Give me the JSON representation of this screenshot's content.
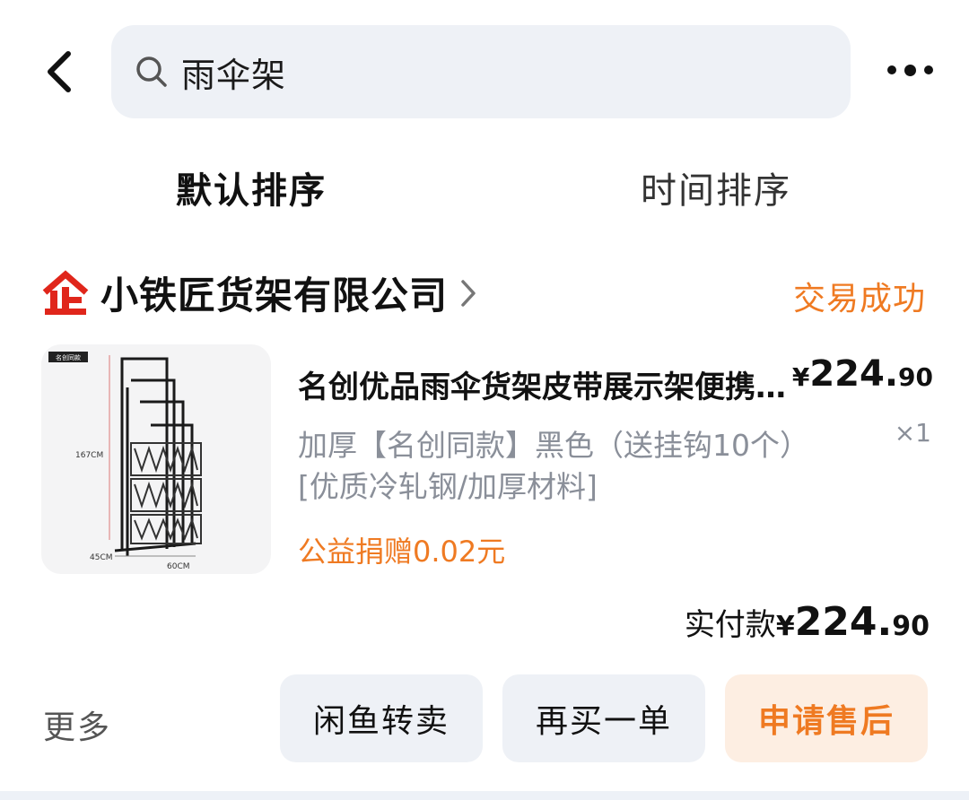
{
  "header": {
    "search_query": "雨伞架"
  },
  "sort_tabs": [
    {
      "label": "默认排序",
      "active": true
    },
    {
      "label": "时间排序",
      "active": false
    }
  ],
  "order": {
    "shop_name": "小铁匠货架有限公司",
    "status": "交易成功",
    "product": {
      "title": "名创优品雨伞货架皮带展示架便携式收纳架",
      "spec": "加厚【名创同款】黑色（送挂钩10个）[优质冷轧钢/加厚材料]",
      "price_symbol": "¥",
      "price_int": "224.",
      "price_dec": "90",
      "quantity": "×1",
      "charity": "公益捐赠0.02元",
      "image_badge": "名创同款",
      "image_dims": {
        "height": "167CM",
        "depth": "45CM",
        "width": "60CM"
      }
    },
    "actual_pay": {
      "label": "实付款",
      "symbol": "¥",
      "int": "224.",
      "dec": "90"
    }
  },
  "actions": {
    "more": "更多",
    "resell": "闲鱼转卖",
    "rebuy": "再买一单",
    "aftersale": "申请售后"
  },
  "colors": {
    "accent_orange": "#ef7a22",
    "button_bg": "#eef1f6",
    "aftersale_bg": "#fdeee2",
    "logo_red": "#e0261b"
  }
}
